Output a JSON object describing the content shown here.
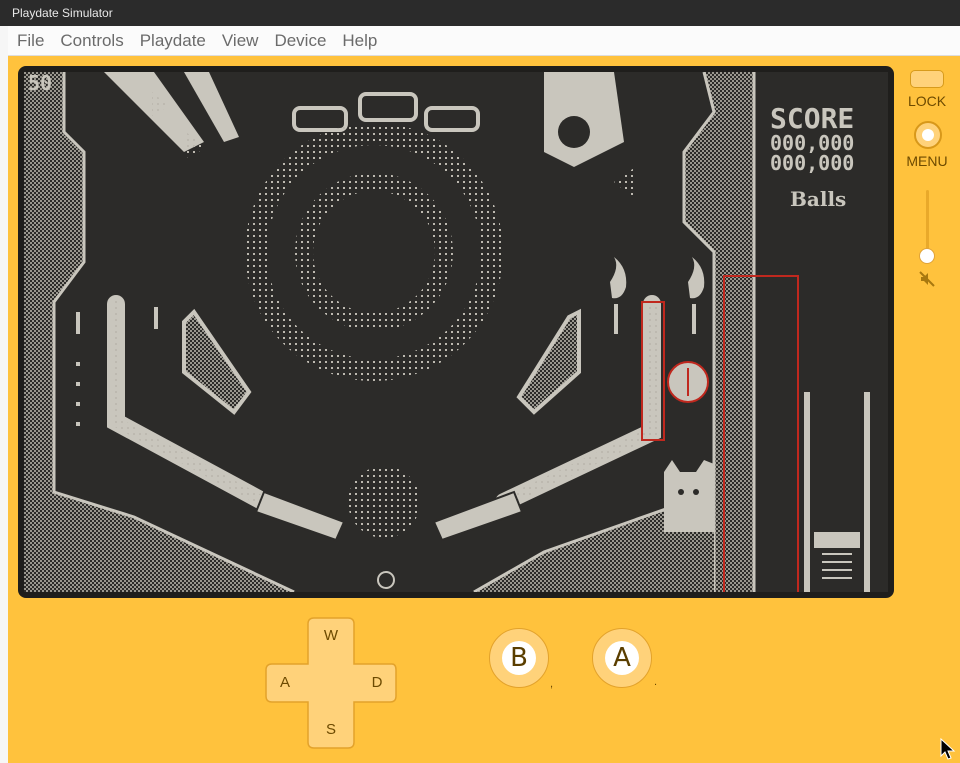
{
  "window": {
    "title": "Playdate Simulator"
  },
  "menubar": {
    "items": [
      "File",
      "Controls",
      "Playdate",
      "View",
      "Device",
      "Help"
    ]
  },
  "game": {
    "fps": "50",
    "score_label": "SCORE",
    "score_line1": "000,000",
    "score_line2": "000,000",
    "balls_label": "Balls"
  },
  "side": {
    "lock_label": "LOCK",
    "menu_label": "MENU"
  },
  "dpad": {
    "up": "W",
    "left": "A",
    "right": "D",
    "down": "S"
  },
  "buttons": {
    "b_label": "B",
    "a_label": "A",
    "b_hint": ",",
    "a_hint": "."
  },
  "colors": {
    "body": "#ffc23d",
    "screen_dark": "#2c2b29",
    "screen_light": "#c9c6bd",
    "debug_red": "#c0281e"
  }
}
